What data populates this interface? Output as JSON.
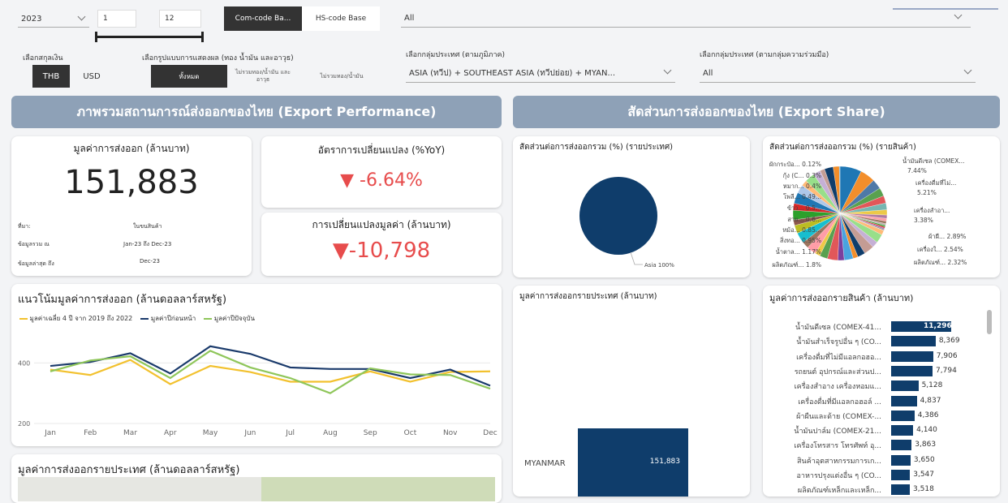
{
  "filters": {
    "year": "2023",
    "month_start": "1",
    "month_end": "12",
    "code_tabs": [
      "Com-code Ba...",
      "HS-code Base"
    ],
    "product_select": "All",
    "currency_label": "เลือกสกุลเงิน",
    "currencies": [
      "THB",
      "USD"
    ],
    "display_label": "เลือกรูปแบบการแสดงผล (ทอง น้ำมัน และอาวุธ)",
    "display_options": [
      "ทั้งหมด",
      "ไม่รวมทอง/น้ำมัน และ อาวุธ",
      "ไม่รวมทอง/น้ำมัน"
    ],
    "region_label": "เลือกกลุ่มประเทศ (ตามภูมิภาค)",
    "region_value": "ASIA (ทวีป) + SOUTHEAST ASIA (ทวีปย่อย) + MYAN...",
    "coop_label": "เลือกกลุ่มประเทศ (ตามกลุ่มความร่วมมือ)",
    "coop_value": "All"
  },
  "banners": {
    "left": "ภาพรวมสถานการณ์ส่งออกของไทย (Export Performance)",
    "right": "สัดส่วนการส่งออกของไทย (Export Share)"
  },
  "kpi": {
    "value_title": "มูลค่าการส่งออก (ล้านบาท)",
    "value": "151,883",
    "source_label": "ที่มา:",
    "source_value": "ในขนสินค้า",
    "period_label": "ข้อมูลรวม ณ",
    "period_value": "Jan-23 ถึง Dec-23",
    "latest_label": "ข้อมูลล่าสุด ถึง",
    "latest_value": "Dec-23",
    "yoy_title": "อัตราการเปลี่ยนแปลง (%YoY)",
    "yoy_value": "▼ -6.64%",
    "change_title": "การเปลี่ยนแปลงมูลค่า (ล้านบาท)",
    "change_value": "▼-10,798"
  },
  "trend": {
    "title": "แนวโน้มมูลค่าการส่งออก (ล้านดอลลาร์สหรัฐ)",
    "legend": [
      "มูลค่าเฉลี่ย 4 ปี จาก 2019 ถึง 2022",
      "มูลค่าปีก่อนหน้า",
      "มูลค่าปีปัจจุบัน"
    ]
  },
  "country_map_title": "มูลค่าการส่งออกรายประเทศ (ล้านดอลลาร์สหรัฐ)",
  "share_country": {
    "title": "สัดส่วนต่อการส่งออกรวม (%) (รายประเทศ)",
    "label": "Asia 100%"
  },
  "share_product": {
    "title": "สัดส่วนต่อการส่งออกรวม (%) (รายสินค้า)",
    "left_labels": [
      "ผักกระป๋อ... 0.12%",
      "กุ้ง (C... 0.3%",
      "หมาก... 0.4%",
      "โพลี... 0.49...",
      "ข้าว... 0.5...",
      "สาย... 0.6...",
      "หม้อ... 0.85...",
      "สิ่งทอ... 0.95%",
      "น้ำตาล... 1.17%",
      "ผลิตภัณฑ์... 1.8%"
    ],
    "right_labels": [
      "น้ำมันดีเซล (COMEX...",
      "7.44%",
      "เครื่องดื่มที่ไม่...",
      "5.21%",
      "เครื่องสำอา...",
      "3.38%",
      "ผ้าผื... 2.89%",
      "เครื่องใ... 2.54%",
      "ผลิตภัณฑ์... 2.32%"
    ]
  },
  "country_bar": {
    "title": "มูลค่าการส่งออกรายประเทศ (ล้านบาท)",
    "category": "MYANMAR",
    "value_label": "151,883"
  },
  "product_bar": {
    "title": "มูลค่าการส่งออกรายสินค้า (ล้านบาท)"
  },
  "chart_data": [
    {
      "type": "line",
      "title": "แนวโน้มมูลค่าการส่งออก (ล้านดอลลาร์สหรัฐ)",
      "x": [
        "Jan",
        "Feb",
        "Mar",
        "Apr",
        "May",
        "Jun",
        "Jul",
        "Aug",
        "Sep",
        "Oct",
        "Nov",
        "Dec"
      ],
      "y_ticks": [
        "200",
        "400"
      ],
      "ylim": [
        200,
        500
      ],
      "series": [
        {
          "name": "มูลค่าเฉลี่ย 4 ปี จาก 2019 ถึง 2022",
          "color": "#f2c12e",
          "values": [
            378,
            360,
            410,
            330,
            390,
            370,
            338,
            338,
            372,
            338,
            370,
            372
          ]
        },
        {
          "name": "มูลค่าปีก่อนหน้า",
          "color": "#1a3a6b",
          "values": [
            390,
            403,
            432,
            365,
            455,
            430,
            385,
            380,
            380,
            350,
            378,
            325
          ]
        },
        {
          "name": "มูลค่าปีปัจจุบัน",
          "color": "#8fc65a",
          "values": [
            372,
            408,
            422,
            350,
            440,
            385,
            350,
            300,
            382,
            362,
            360,
            315
          ]
        }
      ]
    },
    {
      "type": "pie",
      "title": "สัดส่วนต่อการส่งออกรวม (%) (รายประเทศ)",
      "categories": [
        "Asia"
      ],
      "values": [
        100
      ]
    },
    {
      "type": "bar",
      "title": "มูลค่าการส่งออกรายประเทศ (ล้านบาท)",
      "categories": [
        "MYANMAR"
      ],
      "values": [
        151883
      ]
    },
    {
      "type": "bar",
      "title": "มูลค่าการส่งออกรายสินค้า (ล้านบาท)",
      "categories": [
        "น้ำมันดีเซล (COMEX-41...",
        "น้ำมันสำเร็จรูปอื่น ๆ (CO...",
        "เครื่องดื่มที่ไม่มีแอลกอฮอ...",
        "รถยนต์ อุปกรณ์และส่วนป...",
        "เครื่องสำอาง เครื่องหอมแ...",
        "เครื่องดื่มที่มีแอลกอฮอล์ ...",
        "ผ้าผืนและด้าย (COMEX-...",
        "น้ำมันปาล์ม (COMEX-21...",
        "เครื่องโทรสาร โทรศัพท์ อุ...",
        "สินค้าอุตสาหกรรมการเก...",
        "อาหารปรุงแต่งอื่น ๆ (CO...",
        "ผลิตภัณฑ์เหล็กและเหล็ก..."
      ],
      "values": [
        11296,
        8369,
        7906,
        7794,
        5128,
        4837,
        4386,
        4140,
        3863,
        3650,
        3547,
        3518
      ],
      "value_labels": [
        "11,296",
        "8,369",
        "7,906",
        "7,794",
        "5,128",
        "4,837",
        "4,386",
        "4,140",
        "3,863",
        "3,650",
        "3,547",
        "3,518"
      ]
    }
  ]
}
